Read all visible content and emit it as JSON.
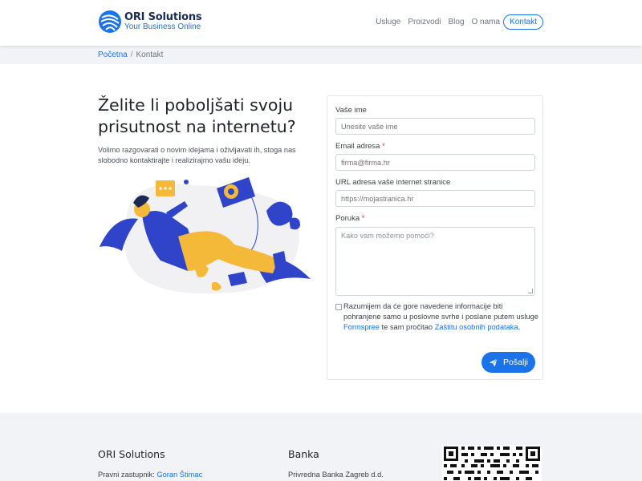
{
  "header": {
    "brand_name": "ORI Solutions",
    "brand_tagline": "Your Business Online",
    "nav": [
      {
        "label": "Usluge"
      },
      {
        "label": "Proizvodi"
      },
      {
        "label": "Blog"
      },
      {
        "label": "O nama"
      },
      {
        "label": "Kontakt",
        "active": true
      }
    ]
  },
  "breadcrumb": {
    "home": "Početna",
    "separator": "/",
    "current": "Kontakt"
  },
  "intro": {
    "headline": "Želite li poboljšati svoju prisutnost na internetu?",
    "lead": "Volimo razgovarati o novim idejama i oživljavati ih, stoga nas slobodno kontaktirajte i realizirajmo vašu ideju.",
    "illustration_icon": "person-on-phone-illustration"
  },
  "form": {
    "name_label": "Vaše ime",
    "name_placeholder": "Unesite vaše ime",
    "email_label": "Email adresa",
    "email_placeholder": "firma@firma.hr",
    "url_label": "URL adresa vaše internet stranice",
    "url_placeholder": "https://mojastranica.hr",
    "message_label": "Poruka",
    "message_placeholder": "Kako vam možemo pomoći?",
    "required_mark": "*",
    "consent_text_1": "Razumijem da će gore navedene informacije biti pohranjene samo u poslovne svrhe i poslane putem usluge",
    "consent_link_1": "Formspree",
    "consent_text_2": "te sam pročitao",
    "consent_link_2": "Zaštitu osobnih podataka",
    "consent_text_3": ".",
    "consent_checked": false,
    "submit_label": "Pošalji",
    "submit_icon": "paper-plane-icon"
  },
  "footer": {
    "company_title": "ORI Solutions",
    "company_line_label": "Pravni zastupnik:",
    "company_line_link": "Goran Štimac",
    "bank_title": "Banka",
    "bank_line": "Privredna Banka Zagreb d.d.",
    "qr_icon": "qr-code-icon"
  },
  "colors": {
    "accent": "#1a73e8",
    "brand_dark": "#1a2a52",
    "footer_bg": "#f1f3f6",
    "illustration_blue": "#2f44c8",
    "illustration_yellow": "#f5b93a"
  }
}
